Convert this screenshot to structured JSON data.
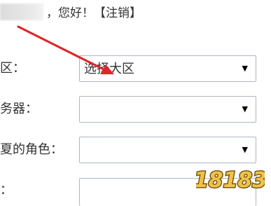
{
  "header": {
    "greeting": "，您好！",
    "logout_link": "【注销】"
  },
  "form": {
    "fields": [
      {
        "label": "区：",
        "selected": "选择大区",
        "caret": "▼"
      },
      {
        "label": "务器：",
        "selected": "",
        "caret": "▼"
      },
      {
        "label": "夏的角色：",
        "selected": "",
        "caret": "▼"
      },
      {
        "label": "：",
        "selected": "",
        "caret": ""
      }
    ]
  },
  "watermark": {
    "text": "18183"
  },
  "colors": {
    "arrow": "#e0262b",
    "watermark_fill": "#f0c24a",
    "watermark_outline": "#7a5a12"
  }
}
